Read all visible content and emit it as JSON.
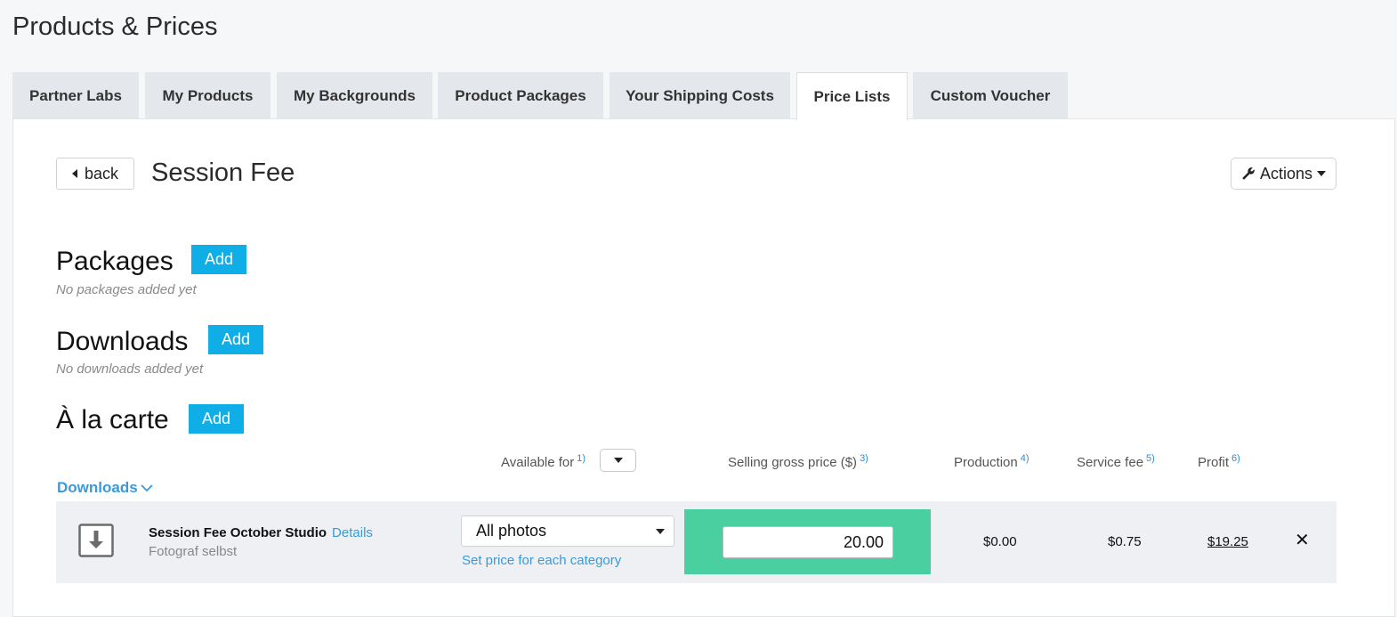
{
  "page": {
    "title": "Products & Prices"
  },
  "tabs": [
    {
      "label": "Partner Labs",
      "active": false
    },
    {
      "label": "My Products",
      "active": false
    },
    {
      "label": "My Backgrounds",
      "active": false
    },
    {
      "label": "Product Packages",
      "active": false
    },
    {
      "label": "Your Shipping Costs",
      "active": false
    },
    {
      "label": "Price Lists",
      "active": true
    },
    {
      "label": "Custom Voucher",
      "active": false
    }
  ],
  "header": {
    "back_label": "back",
    "title": "Session Fee",
    "actions_label": "Actions"
  },
  "sections": {
    "packages": {
      "title": "Packages",
      "add_label": "Add",
      "empty_text": "No packages added yet"
    },
    "downloads": {
      "title": "Downloads",
      "add_label": "Add",
      "empty_text": "No downloads added yet"
    },
    "alacarte": {
      "title": "À la carte",
      "add_label": "Add"
    }
  },
  "table": {
    "columns": {
      "available_for": {
        "label": "Available for",
        "note": "1)"
      },
      "selling_price": {
        "label": "Selling gross price ($)",
        "note": "3)"
      },
      "production": {
        "label": "Production",
        "note": "4)"
      },
      "service_fee": {
        "label": "Service fee",
        "note": "5)"
      },
      "profit": {
        "label": "Profit",
        "note": "6)"
      }
    },
    "group_label": "Downloads",
    "rows": [
      {
        "name": "Session Fee October Studio",
        "details_label": "Details",
        "subtitle": "Fotograf selbst",
        "available_for": "All photos",
        "set_category_link": "Set price for each category",
        "price": "20.00",
        "production": "$0.00",
        "service_fee": "$0.75",
        "profit": "$19.25"
      }
    ]
  },
  "colors": {
    "accent": "#10aee6",
    "price_highlight": "#49cfa0",
    "link": "#3a9ad9"
  }
}
